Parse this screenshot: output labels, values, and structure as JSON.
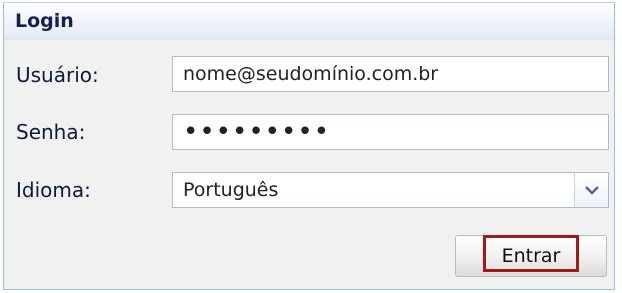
{
  "panel": {
    "title": "Login"
  },
  "form": {
    "user_label": "Usuário:",
    "user_value": "nome@seudomínio.com.br",
    "password_label": "Senha:",
    "password_value": "•••••••••",
    "language_label": "Idioma:",
    "language_value": "Português",
    "language_dropdown_icon": "chevron-down-icon",
    "submit_label": "Entrar"
  },
  "colors": {
    "panel_border": "#99bbe8",
    "title_text": "#15224c",
    "highlight_border": "#a11b1b",
    "dropdown_icon": "#4a6a9a"
  }
}
